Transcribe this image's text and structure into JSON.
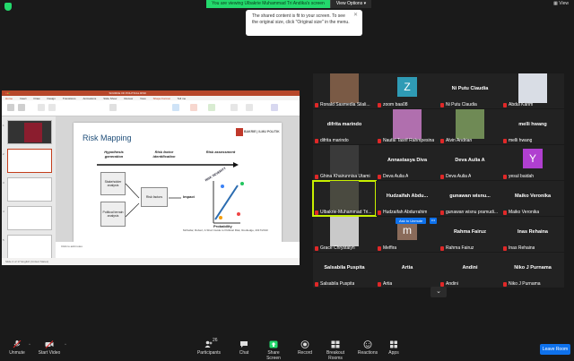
{
  "top": {
    "viewing_banner": "You are viewing Ulbakrie Muhammad Tri Andika's screen",
    "view_options": "View Options",
    "view_label": "View",
    "tooltip": "The shared content is fit to your screen. To see the original size, click \"Original size\" in the menu.",
    "tooltip_close": "✕"
  },
  "ppt": {
    "file_title": "SOURCE OF POLITICAL RISK",
    "menu": [
      "Home",
      "Insert",
      "Draw",
      "Design",
      "Transitions",
      "Animations",
      "Slide Show",
      "Review",
      "View",
      "Shape Format",
      "Tell me"
    ],
    "notes_placeholder": "Click to add notes",
    "status_left": "Slide 2 of 17   English (United States)",
    "slide": {
      "title": "Risk Mapping",
      "logo_text": "BAKRIE | ILMU POLITIK",
      "stage1": "Hypothesis generation",
      "stage2": "Risk factor identification",
      "stage3": "Risk assessment",
      "box_stakeholder": "Stakeholder analysis",
      "box_political": "Political terrain analysis",
      "box_risk_factors": "Risk factors",
      "impact": "Impact",
      "probability": "Probability",
      "risk_severity": "RISK SEVERITY",
      "citation": "McKellar, Robert, A Short Guide to Political Risk, Routledge, 2017/2010"
    }
  },
  "gallery": [
    {
      "name": "Ronald Sasmedia Silali...",
      "kind": "photo",
      "photo_color": "#7a5a45"
    },
    {
      "name": "zoom baa08",
      "kind": "letter",
      "letter": "Z",
      "letter_color": "#2f9bb5"
    },
    {
      "name": "Ni Putu Claudia",
      "kind": "name",
      "center": "Ni Putu Claudia"
    },
    {
      "name": "Abdul Karim",
      "kind": "photo",
      "photo_color": "#d9dde5"
    },
    {
      "name": "difrita marindo",
      "kind": "name",
      "center": "difrita marindo"
    },
    {
      "name": "Naufal Tasrif Rahmpesina",
      "kind": "photo",
      "photo_color": "#b06fae"
    },
    {
      "name": "Alvin Andrian",
      "kind": "photo",
      "photo_color": "#6f8a55"
    },
    {
      "name": "melli hwang",
      "kind": "name",
      "center": "melli hwang"
    },
    {
      "name": "Ghina Khairunnisa Utami",
      "kind": "photo",
      "photo_color": "#3a3a3a"
    },
    {
      "name": "Deva Aulia A",
      "kind": "name",
      "center": "Annastasya Diva"
    },
    {
      "name": "Deva Aulia A",
      "kind": "name",
      "center": "Deva Aulia A"
    },
    {
      "name": "yesul baidah",
      "kind": "letter",
      "letter": "Y",
      "letter_color": "#b03fd0"
    },
    {
      "name": "Ulbakrie-Muhammad Tri...",
      "kind": "photo",
      "photo_color": "#4a4a40",
      "active": true
    },
    {
      "name": "Hudzaifah Abdurrahim",
      "kind": "name",
      "center": "Hudzaifah Abdu..."
    },
    {
      "name": "gunawan wisnu pramudi...",
      "kind": "name",
      "center": "gunawan wisnu..."
    },
    {
      "name": "Maiko Veronika",
      "kind": "name",
      "center": "Maiko Veronika"
    },
    {
      "name": "Grace Chrystalyn",
      "kind": "photo",
      "photo_color": "#c9c9c9"
    },
    {
      "name": "Meffira",
      "kind": "letter",
      "letter": "m",
      "letter_color": "#8a6b5a"
    },
    {
      "name": "Rahma Fairuz",
      "kind": "name",
      "center": "Rahma Fairuz"
    },
    {
      "name": "Inas Rehaina",
      "kind": "name",
      "center": "Inas Rehaina"
    },
    {
      "name": "Salsabila Puspita",
      "kind": "name",
      "center": "Salsabila Puspita"
    },
    {
      "name": "Artia",
      "kind": "name",
      "center": "Artia"
    },
    {
      "name": "Andini",
      "kind": "name",
      "center": "Andini"
    },
    {
      "name": "Niko J Purnama",
      "kind": "name",
      "center": "Niko J Purnama"
    }
  ],
  "ask_to_unmute": "Ask to Unmute",
  "more": "•••",
  "toolbar": {
    "unmute": "Unmute",
    "start_video": "Start Video",
    "participants": "Participants",
    "participants_count": "26",
    "chat": "Chat",
    "share_screen": "Share Screen",
    "record": "Record",
    "breakout": "Breakout Rooms",
    "reactions": "Reactions",
    "apps": "Apps",
    "leave": "Leave Room"
  },
  "colors": {
    "share_green": "#23d96c",
    "zoom_blue": "#0e71eb",
    "active_speaker": "#c8f000",
    "muted_red": "#e02828"
  }
}
